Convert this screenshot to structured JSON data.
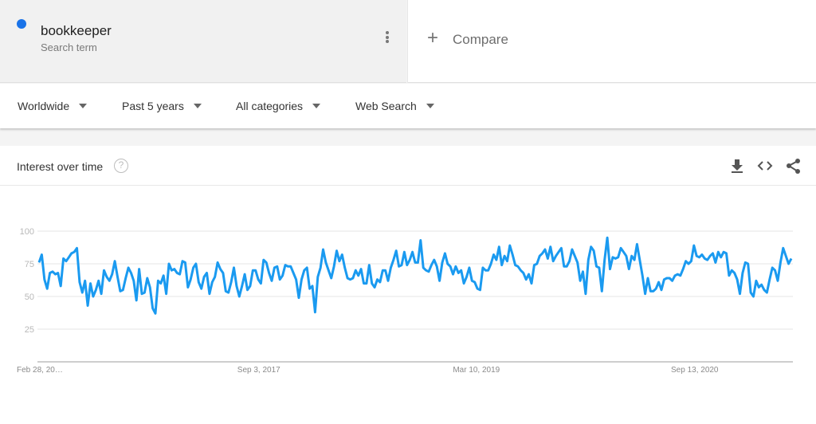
{
  "term": {
    "name": "bookkeeper",
    "subtitle": "Search term",
    "color": "#1a73e8",
    "more_icon": "more-vert-icon"
  },
  "compare": {
    "label": "Compare",
    "icon": "plus-icon"
  },
  "filters": [
    {
      "label": "Worldwide"
    },
    {
      "label": "Past 5 years"
    },
    {
      "label": "All categories"
    },
    {
      "label": "Web Search"
    }
  ],
  "card": {
    "title": "Interest over time",
    "help_icon": "help-icon",
    "actions": [
      "download-icon",
      "embed-code-icon",
      "share-icon"
    ]
  },
  "chart_data": {
    "type": "line",
    "title": "Interest over time",
    "xlabel": "",
    "ylabel": "",
    "ylim": [
      0,
      100
    ],
    "yticks": [
      25,
      50,
      75,
      100
    ],
    "xtick_labels": [
      "Feb 28, 20…",
      "Sep 3, 2017",
      "Mar 10, 2019",
      "Sep 13, 2020"
    ],
    "xtick_positions": [
      0,
      0.293,
      0.581,
      0.87
    ],
    "grid": true,
    "line_color": "#1a9af0",
    "series": [
      {
        "name": "bookkeeper",
        "values": [
          76,
          82,
          63,
          56,
          68,
          69,
          67,
          68,
          58,
          79,
          77,
          80,
          83,
          84,
          87,
          61,
          53,
          62,
          43,
          60,
          50,
          55,
          62,
          52,
          70,
          65,
          62,
          67,
          77,
          65,
          54,
          55,
          64,
          72,
          68,
          62,
          47,
          71,
          52,
          53,
          64,
          57,
          41,
          37,
          62,
          60,
          66,
          52,
          75,
          70,
          71,
          68,
          67,
          77,
          76,
          57,
          63,
          72,
          75,
          61,
          56,
          65,
          68,
          52,
          61,
          65,
          76,
          71,
          68,
          54,
          53,
          61,
          72,
          58,
          50,
          58,
          67,
          55,
          58,
          70,
          70,
          63,
          60,
          78,
          76,
          68,
          62,
          72,
          73,
          63,
          66,
          74,
          73,
          73,
          68,
          63,
          49,
          63,
          70,
          72,
          56,
          58,
          38,
          65,
          72,
          86,
          76,
          70,
          64,
          73,
          85,
          77,
          82,
          72,
          64,
          63,
          64,
          70,
          66,
          71,
          60,
          60,
          74,
          60,
          57,
          63,
          61,
          70,
          70,
          62,
          72,
          78,
          85,
          73,
          74,
          84,
          74,
          78,
          84,
          76,
          76,
          93,
          72,
          70,
          69,
          74,
          78,
          73,
          62,
          76,
          83,
          75,
          73,
          67,
          73,
          68,
          70,
          60,
          65,
          72,
          62,
          61,
          56,
          55,
          72,
          70,
          70,
          75,
          82,
          78,
          88,
          74,
          81,
          77,
          89,
          82,
          74,
          73,
          70,
          68,
          63,
          67,
          60,
          74,
          75,
          81,
          83,
          86,
          79,
          88,
          77,
          81,
          84,
          87,
          73,
          73,
          77,
          86,
          81,
          76,
          62,
          69,
          52,
          78,
          88,
          85,
          73,
          72,
          54,
          78,
          95,
          71,
          80,
          79,
          80,
          87,
          84,
          81,
          71,
          81,
          78,
          90,
          78,
          66,
          52,
          64,
          54,
          54,
          56,
          61,
          55,
          63,
          64,
          64,
          62,
          66,
          67,
          66,
          71,
          77,
          75,
          77,
          89,
          81,
          80,
          82,
          79,
          78,
          81,
          83,
          76,
          84,
          80,
          84,
          83,
          66,
          70,
          68,
          63,
          52,
          68,
          76,
          75,
          53,
          50,
          62,
          57,
          59,
          55,
          53,
          63,
          72,
          70,
          62,
          76,
          87,
          81,
          75,
          79
        ]
      }
    ]
  }
}
